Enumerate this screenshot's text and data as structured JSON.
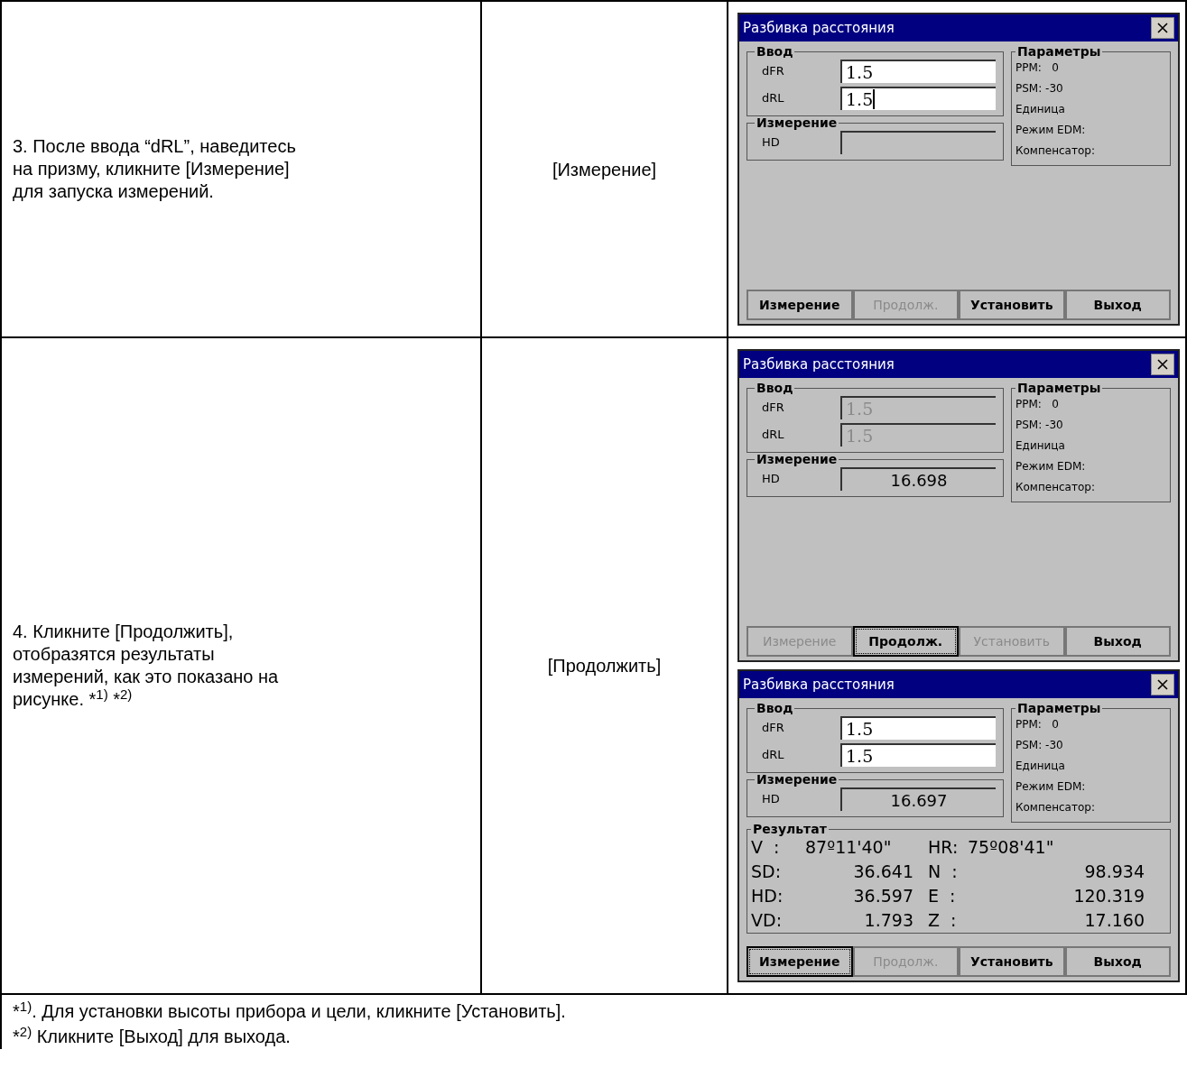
{
  "rows": [
    {
      "step": "3. После ввода “dRL”, наведитесь на призму, кликните [Измерение] для запуска измерений.",
      "key": "[Измерение]",
      "screens": [
        {
          "title": "Разбивка расстояния",
          "input_group": "Ввод",
          "inputs": [
            {
              "label": "dFR",
              "value": "1.5",
              "disabled": false,
              "caret": false
            },
            {
              "label": "dRL",
              "value": "1.5",
              "disabled": false,
              "caret": true
            }
          ],
          "measure_group": "Измерение",
          "measure_label": "HD",
          "params_group": "Параметры",
          "params": [
            "PPM:   0",
            "PSM: -30",
            "Единица",
            "Режим EDM:",
            "Компенсатор:"
          ],
          "buttons": [
            {
              "label": "Измерение",
              "disabled": false,
              "focused": false
            },
            {
              "label": "Продолж.",
              "disabled": true,
              "focused": false
            },
            {
              "label": "Установить",
              "disabled": false,
              "focused": false
            },
            {
              "label": "Выход",
              "disabled": false,
              "focused": false
            }
          ]
        }
      ]
    },
    {
      "step": "4. Кликните [Продолжить], отобразятся результаты измерений, как это показано на рисунке. *$^{1)}$ *$^{2)}$",
      "key": "[Продолжить]",
      "screens": [
        {
          "title": "Разбивка расстояния",
          "input_group": "Ввод",
          "inputs": [
            {
              "label": "dFR",
              "value": "1.5",
              "disabled": true,
              "caret": false
            },
            {
              "label": "dRL",
              "value": "1.5",
              "disabled": true,
              "caret": false
            }
          ],
          "measure_group": "Измерение",
          "measure_label": "HD",
          "measure_value": "16.698",
          "params_group": "Параметры",
          "params": [
            "PPM:   0",
            "PSM: -30",
            "Единица",
            "Режим EDM:",
            "Компенсатор:"
          ],
          "buttons": [
            {
              "label": "Измерение",
              "disabled": true,
              "focused": false
            },
            {
              "label": "Продолж.",
              "disabled": false,
              "focused": true
            },
            {
              "label": "Установить",
              "disabled": true,
              "focused": false
            },
            {
              "label": "Выход",
              "disabled": false,
              "focused": false
            }
          ]
        },
        {
          "title": "Разбивка расстояния",
          "input_group": "Ввод",
          "inputs": [
            {
              "label": "dFR",
              "value": "1.5",
              "disabled": false,
              "caret": false
            },
            {
              "label": "dRL",
              "value": "1.5",
              "disabled": false,
              "caret": false
            }
          ],
          "measure_group": "Измерение",
          "measure_label": "HD",
          "measure_value": "16.697",
          "params_group": "Параметры",
          "params": [
            "PPM:   0",
            "PSM: -30",
            "Единица",
            "Режим EDM:",
            "Компенсатор:"
          ],
          "result": {
            "title": "Результат",
            "rows": [
              {
                "left_label": "V  :",
                "left_value": "87º11'40\"",
                "right_label": "HR:",
                "right_value": "75º08'41\""
              },
              {
                "left_label": "SD:",
                "left_value": "36.641",
                "right_label": "N  :",
                "right_value": "98.934"
              },
              {
                "left_label": "HD:",
                "left_value": "36.597",
                "right_label": "E  :",
                "right_value": "120.319"
              },
              {
                "left_label": "VD:",
                "left_value": "1.793",
                "right_label": "Z  :",
                "right_value": "17.160"
              }
            ]
          },
          "buttons": [
            {
              "label": "Измерение",
              "disabled": false,
              "focused": true
            },
            {
              "label": "Продолж.",
              "disabled": true,
              "focused": false
            },
            {
              "label": "Установить",
              "disabled": false,
              "focused": false
            },
            {
              "label": "Выход",
              "disabled": false,
              "focused": false
            }
          ]
        }
      ]
    }
  ],
  "footnotes": [
    "*$^{1)}$. Для установки высоты прибора и цели, кликните [Установить].",
    "*$^{2)}$ Кликните [Выход] для выхода."
  ]
}
